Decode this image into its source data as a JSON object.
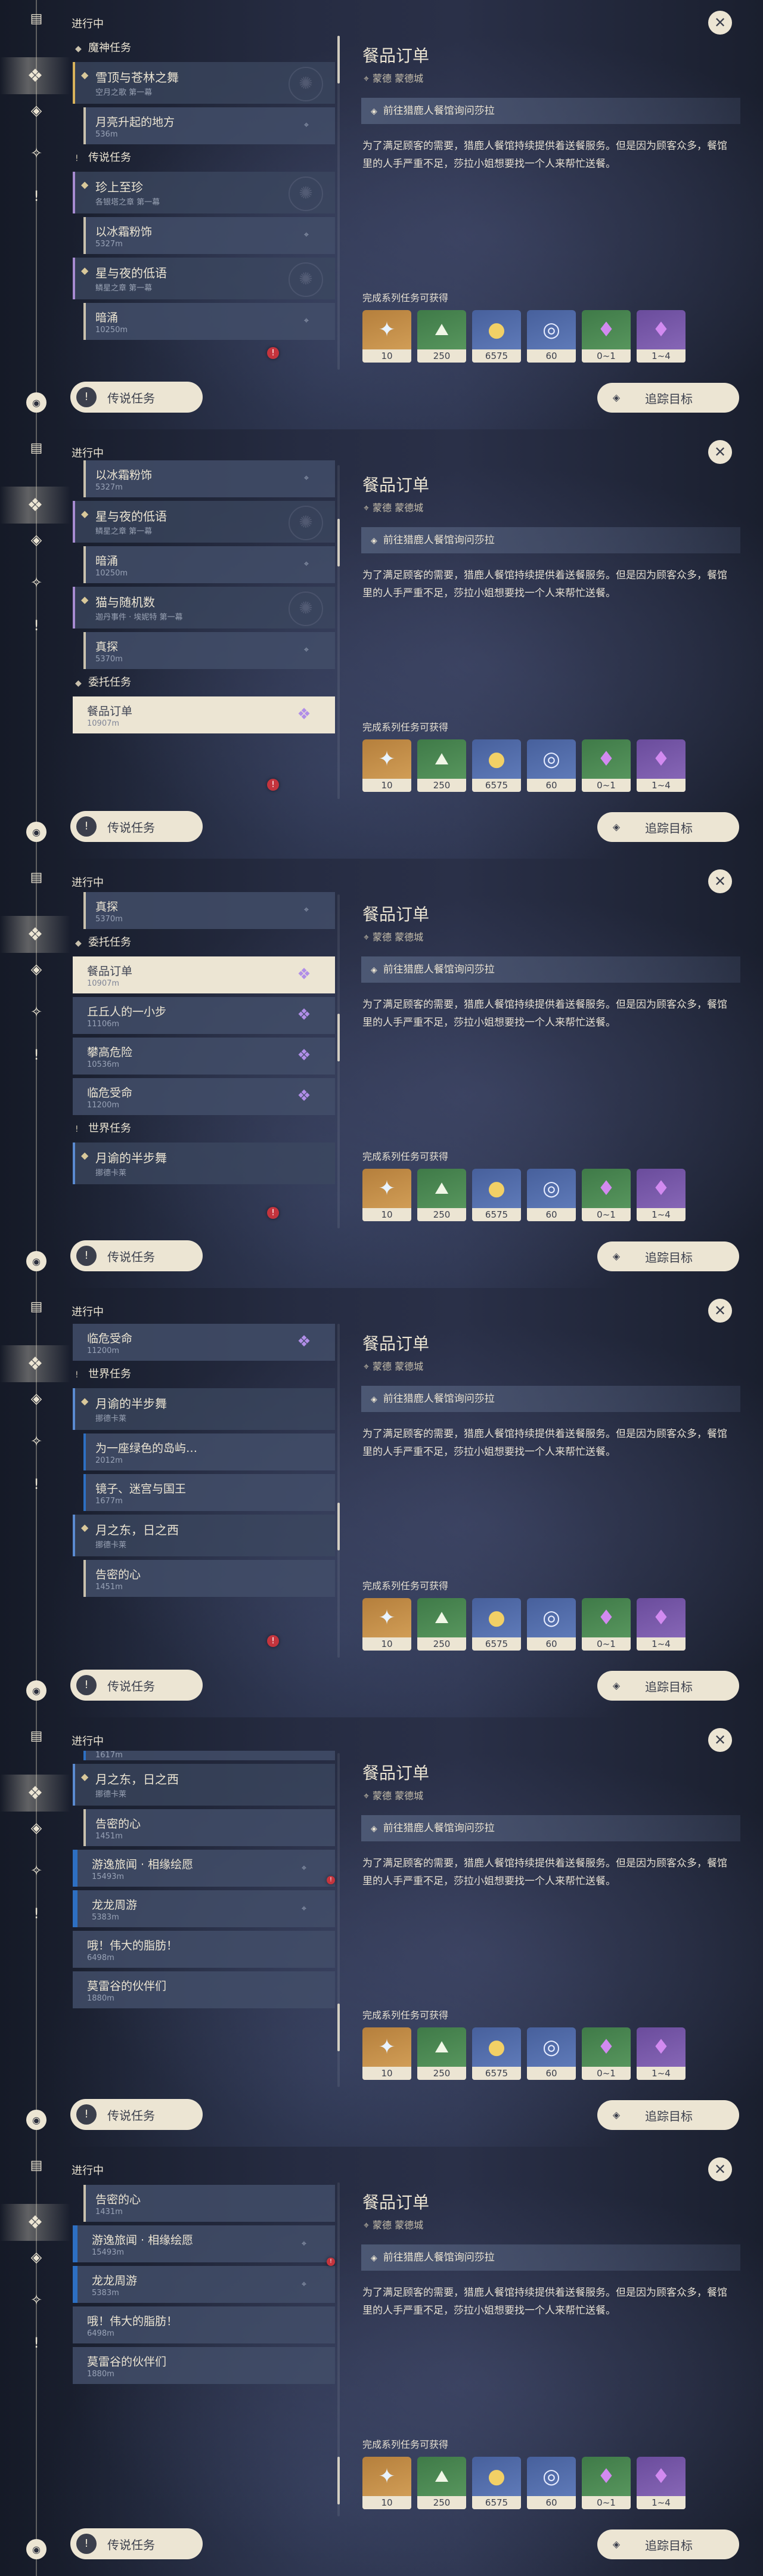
{
  "ui": {
    "in_progress": "进行中",
    "section_archon": "魔神任务",
    "section_legend": "传说任务",
    "section_commission": "委托任务",
    "section_world": "世界任务",
    "legend_button": "传说任务",
    "track_button": "追踪目标",
    "close": "✕"
  },
  "detail": {
    "title": "餐品订单",
    "location": "蒙德 蒙德城",
    "step": "前往猎鹿人餐馆询问莎拉",
    "description": "为了满足顾客的需要，猎鹿人餐馆持续提供着送餐服务。但是因为顾客众多，餐馆里的人手严重不足，莎拉小姐想要找一个人来帮忙送餐。",
    "rewards_title": "完成系列任务可获得",
    "rewards": [
      {
        "icon": "primogem-icon",
        "count": "10",
        "color": "orange"
      },
      {
        "icon": "adventure-exp-icon",
        "count": "250",
        "color": "green"
      },
      {
        "icon": "mora-icon",
        "count": "6575",
        "color": "blue"
      },
      {
        "icon": "companionship-exp-icon",
        "count": "60",
        "color": "blue"
      },
      {
        "icon": "crystal-green-icon",
        "count": "0~1",
        "color": "green"
      },
      {
        "icon": "crystal-purple-icon",
        "count": "1~4",
        "color": "purple"
      }
    ]
  },
  "quests": {
    "archon_1_title": "雪顶与苍林之舞",
    "archon_1_sub": "空月之歌 第一幕",
    "archon_1_step": "月亮升起的地方",
    "archon_1_dist": "536m",
    "legend_1_title": "珍上至珍",
    "legend_1_sub": "各银塔之章 第一幕",
    "legend_1_step": "以冰霜粉饰",
    "legend_1_dist": "5327m",
    "legend_2_title": "星与夜的低语",
    "legend_2_sub": "鳞星之章 第一幕",
    "legend_2_step": "暗涌",
    "legend_2_dist": "10250m",
    "legend_3_title": "猫与随机数",
    "legend_3_sub": "迦丹事件 · 埃妮特 第一幕",
    "legend_3_step": "真探",
    "legend_3_dist": "5370m",
    "commission_1": "餐品订单",
    "commission_1_dist": "10907m",
    "commission_2": "丘丘人的一小步",
    "commission_2_dist": "11106m",
    "commission_3": "攀高危险",
    "commission_3_dist": "10536m",
    "commission_4": "临危受命",
    "commission_4_dist": "11200m",
    "world_1_title": "月谕的半步舞",
    "world_1_sub": "挪德卡莱",
    "world_1_step_1": "为一座绿色的岛屿…",
    "world_1_step_1_dist": "2012m",
    "world_1_step_2": "镜子、迷宫与国王",
    "world_1_step_2_dist": "1677m",
    "world_2_title": "月之东，日之西",
    "world_2_sub": "挪德卡莱",
    "world_2_step_1": "告密的心",
    "world_2_step_1_dist": "1451m",
    "world_2_step_1_dist_alt": "1431m",
    "world_3_title": "游逸旅闻 · 相缘绘愿",
    "world_3_dist": "15493m",
    "world_4_title": "龙龙周游",
    "world_4_dist": "5383m",
    "world_5_title": "哦！伟大的脂肪！",
    "world_5_dist": "6498m",
    "world_6_title": "莫雷谷的伙伴们",
    "world_6_dist": "1880m",
    "faded_dist": "1617m"
  },
  "icons": {
    "book": "book-icon",
    "compass": "compass-icon",
    "star": "star-icon",
    "diamond": "diamond-icon",
    "alert": "exclamation-icon",
    "camera": "camera-icon"
  },
  "colors": {
    "selected_bg": "#ece5d3",
    "commission_icon": "#b18ee8",
    "alert_red": "#c4343d",
    "world_bar": "#2d6fc2"
  }
}
